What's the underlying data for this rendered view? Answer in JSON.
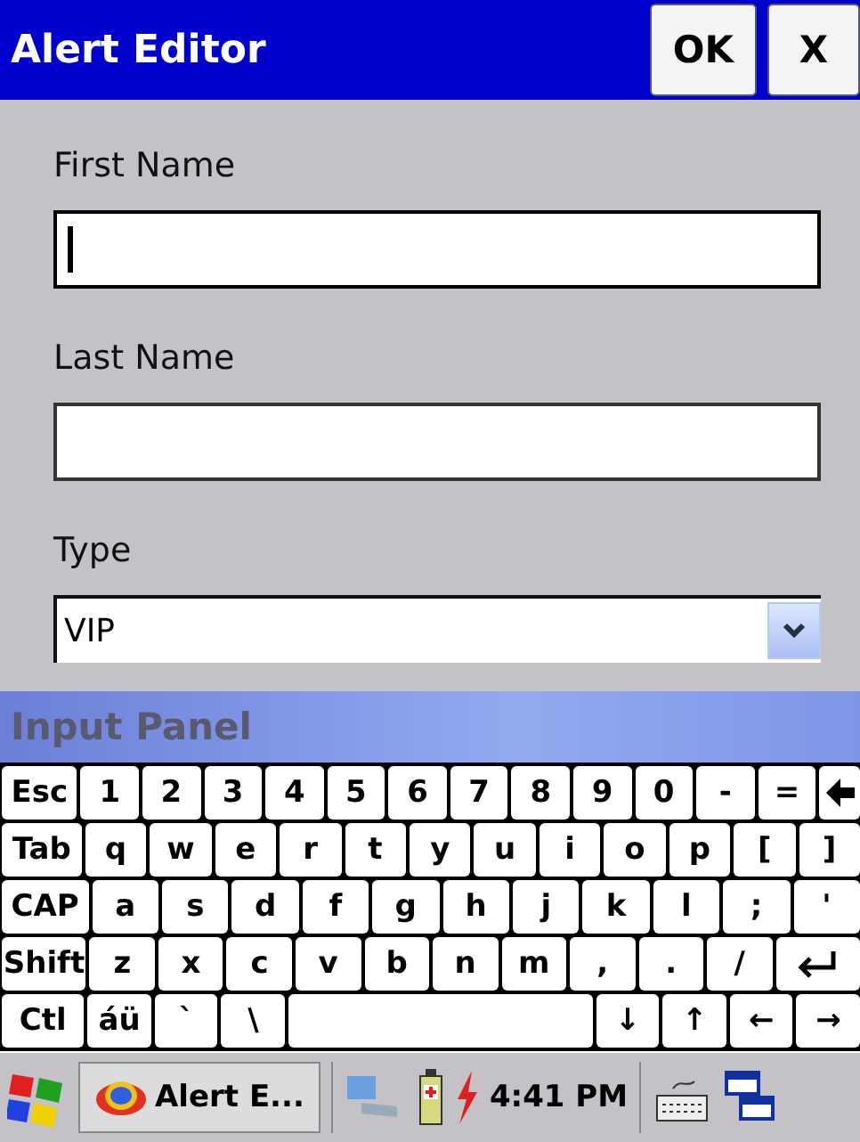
{
  "window": {
    "title": "Alert Editor",
    "buttons": [
      "OK",
      "X"
    ]
  },
  "form": {
    "fields": [
      {
        "kind": "text",
        "label": "First Name",
        "focused": true
      },
      {
        "kind": "text",
        "label": "Last Name",
        "focused": false
      },
      {
        "kind": "select",
        "label": "Type",
        "value": "VIP"
      }
    ]
  },
  "input_panel": {
    "title": "Input Panel",
    "rows": [
      [
        {
          "kind": "key",
          "label": "Esc"
        },
        {
          "kind": "key",
          "label": "1"
        },
        {
          "kind": "key",
          "label": "2"
        },
        {
          "kind": "key",
          "label": "3"
        },
        {
          "kind": "key",
          "label": "4"
        },
        {
          "kind": "key",
          "label": "5"
        },
        {
          "kind": "key",
          "label": "6"
        },
        {
          "kind": "key",
          "label": "7"
        },
        {
          "kind": "key",
          "label": "8"
        },
        {
          "kind": "key",
          "label": "9"
        },
        {
          "kind": "key",
          "label": "0"
        },
        {
          "kind": "key",
          "label": "-"
        },
        {
          "kind": "key",
          "label": "="
        },
        {
          "kind": "backspace"
        }
      ],
      [
        {
          "kind": "key",
          "label": "Tab"
        },
        {
          "kind": "key",
          "label": "q"
        },
        {
          "kind": "key",
          "label": "w"
        },
        {
          "kind": "key",
          "label": "e"
        },
        {
          "kind": "key",
          "label": "r"
        },
        {
          "kind": "key",
          "label": "t"
        },
        {
          "kind": "key",
          "label": "y"
        },
        {
          "kind": "key",
          "label": "u"
        },
        {
          "kind": "key",
          "label": "i"
        },
        {
          "kind": "key",
          "label": "o"
        },
        {
          "kind": "key",
          "label": "p"
        },
        {
          "kind": "key",
          "label": "["
        },
        {
          "kind": "key",
          "label": "]"
        }
      ],
      [
        {
          "kind": "key",
          "label": "CAP"
        },
        {
          "kind": "key",
          "label": "a"
        },
        {
          "kind": "key",
          "label": "s"
        },
        {
          "kind": "key",
          "label": "d"
        },
        {
          "kind": "key",
          "label": "f"
        },
        {
          "kind": "key",
          "label": "g"
        },
        {
          "kind": "key",
          "label": "h"
        },
        {
          "kind": "key",
          "label": "j"
        },
        {
          "kind": "key",
          "label": "k"
        },
        {
          "kind": "key",
          "label": "l"
        },
        {
          "kind": "key",
          "label": ";"
        },
        {
          "kind": "key",
          "label": "'"
        }
      ],
      [
        {
          "kind": "key",
          "label": "Shift"
        },
        {
          "kind": "key",
          "label": "z"
        },
        {
          "kind": "key",
          "label": "x"
        },
        {
          "kind": "key",
          "label": "c"
        },
        {
          "kind": "key",
          "label": "v"
        },
        {
          "kind": "key",
          "label": "b"
        },
        {
          "kind": "key",
          "label": "n"
        },
        {
          "kind": "key",
          "label": "m"
        },
        {
          "kind": "key",
          "label": ","
        },
        {
          "kind": "key",
          "label": "."
        },
        {
          "kind": "key",
          "label": "/"
        },
        {
          "kind": "enter"
        }
      ],
      [
        {
          "kind": "key",
          "label": "Ctl"
        },
        {
          "kind": "key",
          "label": "áü"
        },
        {
          "kind": "key",
          "label": "`"
        },
        {
          "kind": "key",
          "label": "\\"
        },
        {
          "kind": "space"
        },
        {
          "kind": "key",
          "label": "↓"
        },
        {
          "kind": "key",
          "label": "↑"
        },
        {
          "kind": "key",
          "label": "←"
        },
        {
          "kind": "key",
          "label": "→"
        }
      ]
    ]
  },
  "taskbar": {
    "app_button": "Alert E...",
    "time": "4:41 PM"
  }
}
